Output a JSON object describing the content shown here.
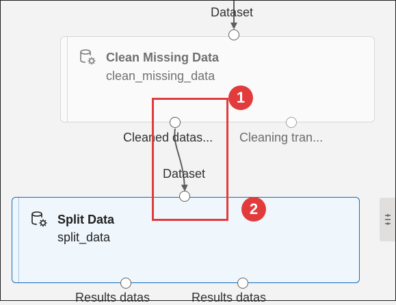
{
  "canvas": {
    "top_input_label": "Dataset",
    "connection_input_label": "Dataset"
  },
  "clean_node": {
    "title": "Clean Missing Data",
    "subtitle": "clean_missing_data",
    "icon": "dataset-gear-icon",
    "outputs": [
      "Cleaned datas...",
      "Cleaning tran..."
    ]
  },
  "split_node": {
    "title": "Split Data",
    "subtitle": "split_data",
    "icon": "dataset-gear-icon",
    "outputs": [
      "Results datas",
      "Results datas"
    ]
  },
  "callouts": [
    "1",
    "2"
  ],
  "side_panel": {
    "icon": "panel-toggle-icon"
  },
  "colors": {
    "highlight": "#e23b3b",
    "selected_border": "#0f6cbd",
    "selected_fill": "#eff6fc",
    "connector": "#605e5c"
  }
}
